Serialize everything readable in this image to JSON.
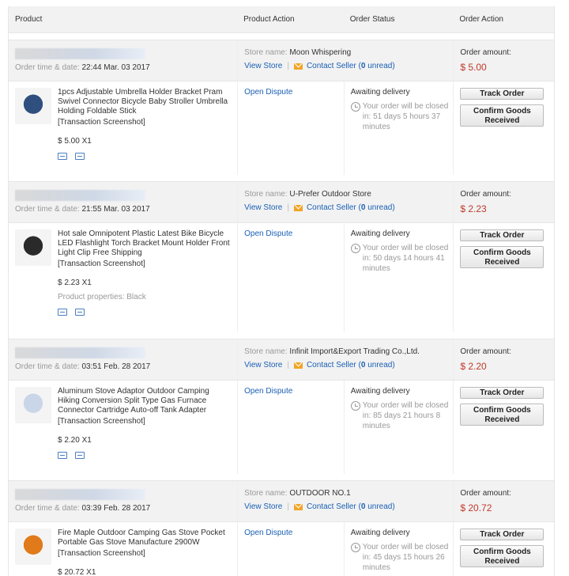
{
  "header": {
    "product": "Product",
    "product_action": "Product Action",
    "order_status": "Order Status",
    "order_action": "Order Action"
  },
  "labels": {
    "order_time": "Order time & date:",
    "store_name": "Store name:",
    "view_store": "View Store",
    "contact_seller": "Contact Seller",
    "unread": "(0 unread)",
    "order_amount": "Order amount:",
    "open_dispute": "Open Dispute",
    "track_order": "Track Order",
    "confirm_goods": "Confirm Goods Received",
    "transaction_screenshot": "[Transaction Screenshot]"
  },
  "orders": [
    {
      "time": "22:44 Mar. 03 2017",
      "store": "Moon Whispering",
      "amount": "$ 5.00",
      "product_name": "1pcs Adjustable Umbrella Holder Bracket Pram Swivel Connector Bicycle Baby Stroller Umbrella Holding Foldable Stick",
      "price": "$ 5.00 X1",
      "properties": "",
      "status": "Awaiting delivery",
      "closing": "Your order will be closed in: 51 days 5 hours 37 minutes",
      "thumb_color": "#2f4f7f"
    },
    {
      "time": "21:55 Mar. 03 2017",
      "store": "U-Prefer Outdoor Store",
      "amount": "$ 2.23",
      "product_name": "Hot sale Omnipotent Plastic Latest Bike Bicycle LED Flashlight Torch Bracket Mount Holder Front Light Clip Free Shipping",
      "price": "$ 2.23 X1",
      "properties": "Product properties: Black",
      "status": "Awaiting delivery",
      "closing": "Your order will be closed in: 50 days 14 hours 41 minutes",
      "thumb_color": "#2a2a2a"
    },
    {
      "time": "03:51 Feb. 28 2017",
      "store": "Infinit Import&Export Trading Co.,Ltd.",
      "amount": "$ 2.20",
      "product_name": "Aluminum Stove Adaptor Outdoor Camping Hiking Conversion Split Type Gas Furnace Connector Cartridge Auto-off Tank Adapter",
      "price": "$ 2.20 X1",
      "properties": "",
      "status": "Awaiting delivery",
      "closing": "Your order will be closed in: 85 days 21 hours 8 minutes",
      "thumb_color": "#c9d6e8"
    },
    {
      "time": "03:39 Feb. 28 2017",
      "store": "OUTDOOR NO.1",
      "amount": "$ 20.72",
      "product_name": "Fire Maple Outdoor Camping Gas Stove Pocket Portable Gas Stove Manufacture 2900W",
      "price": "$ 20.72 X1",
      "properties": "",
      "status": "Awaiting delivery",
      "closing": "Your order will be closed in: 45 days 15 hours 26 minutes",
      "thumb_color": "#e07a1a"
    }
  ]
}
